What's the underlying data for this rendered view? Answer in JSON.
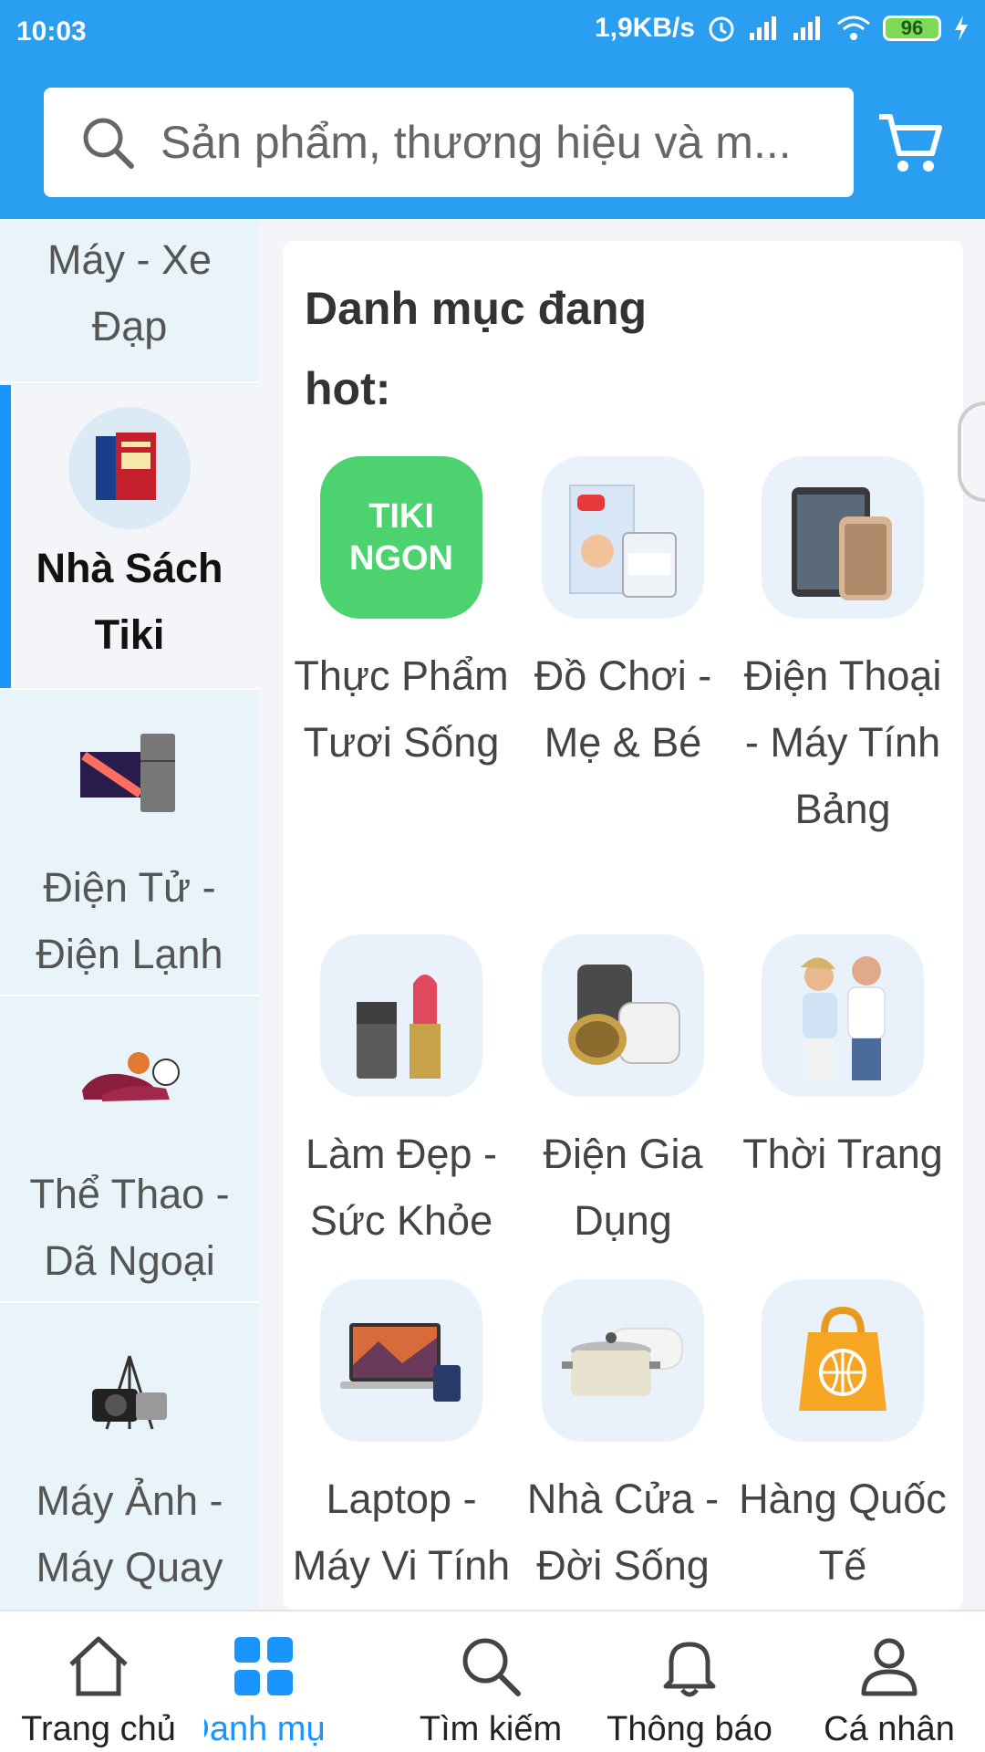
{
  "status": {
    "time": "10:03",
    "speed": "1,9KB/s",
    "battery": "96"
  },
  "search": {
    "placeholder": "Sản phẩm, thương hiệu và m..."
  },
  "sidebar": {
    "items": [
      {
        "label": "Máy - Xe Đạp"
      },
      {
        "label": "Nhà Sách Tiki"
      },
      {
        "label": "Điện Tử - Điện Lạnh"
      },
      {
        "label": "Thể Thao - Dã Ngoại"
      },
      {
        "label": "Máy Ảnh - Máy Quay Phim"
      }
    ]
  },
  "main": {
    "title": "Danh mục đang hot:",
    "categories": [
      {
        "label": "Thực Phẩm Tươi Sống",
        "icon": "tiki-ngon-logo",
        "logo_text": "TIKI NGON"
      },
      {
        "label": "Đồ Chơi - Mẹ & Bé",
        "icon": "diapers-milk-icon"
      },
      {
        "label": "Điện Thoại - Máy Tính Bảng",
        "icon": "phone-tablet-icon"
      },
      {
        "label": "Làm Đẹp - Sức Khỏe",
        "icon": "lipstick-perfume-icon"
      },
      {
        "label": "Điện Gia Dụng",
        "icon": "rice-cooker-pan-icon"
      },
      {
        "label": "Thời Trang",
        "icon": "fashion-models-icon"
      },
      {
        "label": "Laptop - Máy Vi Tính",
        "icon": "laptop-icon"
      },
      {
        "label": "Nhà Cửa - Đời Sống",
        "icon": "pot-pillow-icon"
      },
      {
        "label": "Hàng Quốc Tế",
        "icon": "global-bag-icon"
      }
    ]
  },
  "bottom_nav": {
    "items": [
      {
        "label": "Trang chủ",
        "icon": "home-icon"
      },
      {
        "label": "Danh mục",
        "icon": "grid-icon",
        "active": true
      },
      {
        "label": "Tìm kiếm",
        "icon": "search-icon"
      },
      {
        "label": "Thông báo",
        "icon": "bell-icon"
      },
      {
        "label": "Cá nhân",
        "icon": "user-icon"
      }
    ]
  },
  "colors": {
    "header": "#2a9ff2",
    "accent": "#1a94ff",
    "sidebar_bg": "#e8f3fa"
  }
}
